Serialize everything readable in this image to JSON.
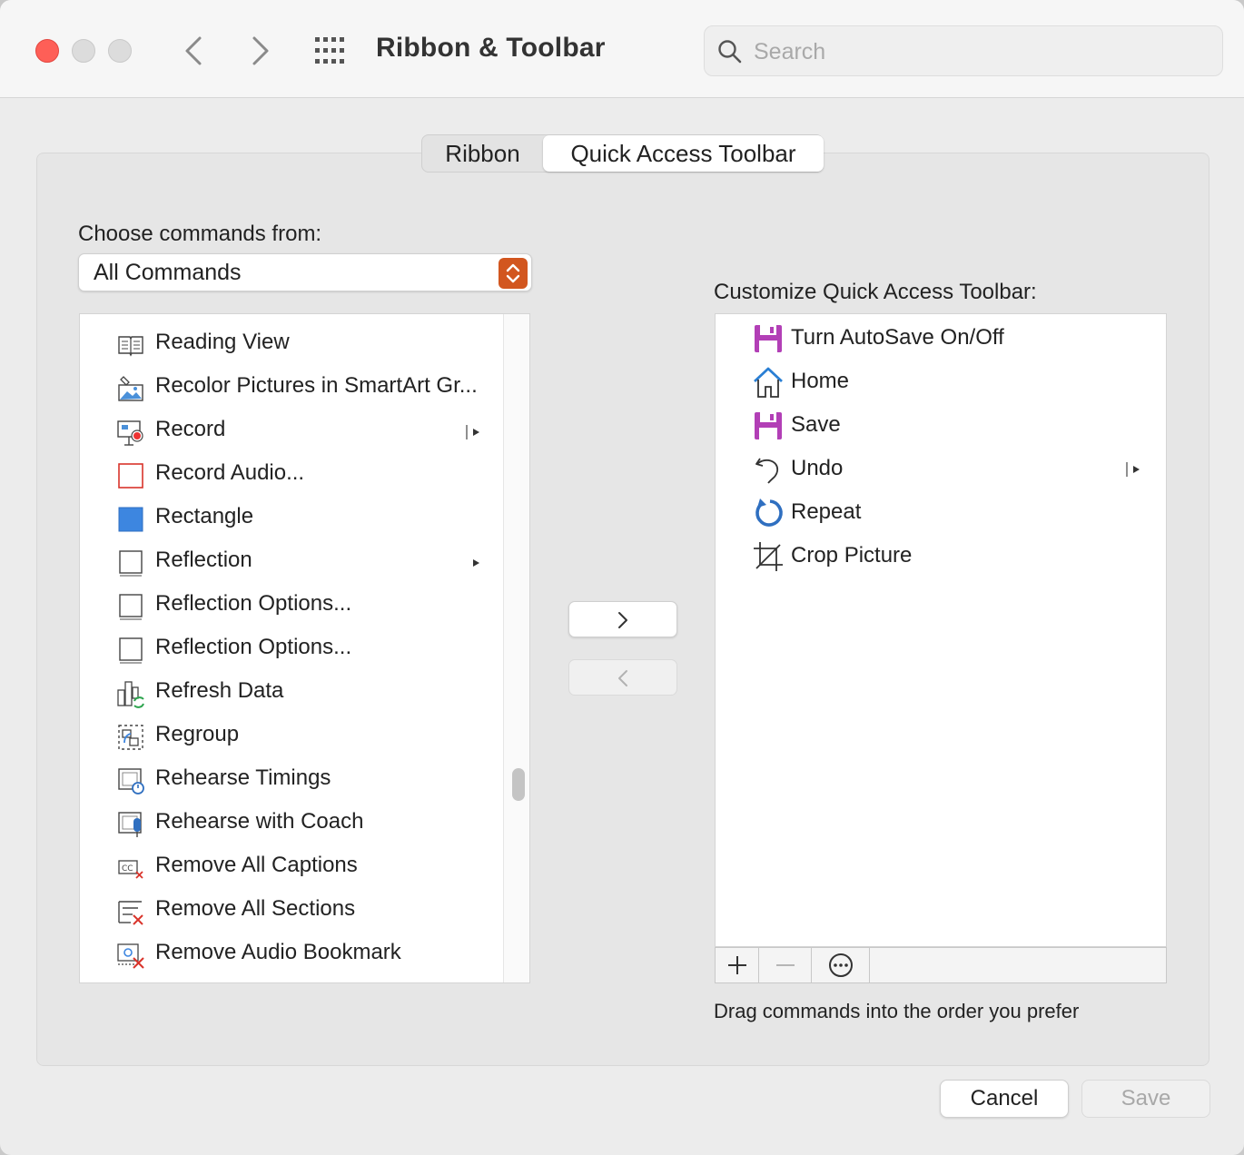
{
  "window": {
    "title": "Ribbon & Toolbar",
    "search_placeholder": "Search"
  },
  "tabs": [
    {
      "label": "Ribbon",
      "selected": false
    },
    {
      "label": "Quick Access Toolbar",
      "selected": true
    }
  ],
  "left": {
    "choose_label": "Choose commands from:",
    "source_value": "All Commands",
    "commands": [
      {
        "label": "Reading View",
        "icon": "reading-view-icon",
        "submenu": false
      },
      {
        "label": "Recolor Pictures in SmartArt Gr...",
        "icon": "recolor-pictures-icon",
        "submenu": false
      },
      {
        "label": "Record",
        "icon": "record-icon",
        "submenu": true
      },
      {
        "label": "Record Audio...",
        "icon": "record-audio-icon",
        "submenu": false
      },
      {
        "label": "Rectangle",
        "icon": "rectangle-icon",
        "submenu": false
      },
      {
        "label": "Reflection",
        "icon": "reflection-icon",
        "submenu": true
      },
      {
        "label": "Reflection Options...",
        "icon": "reflection-options-icon",
        "submenu": false
      },
      {
        "label": "Reflection Options...",
        "icon": "reflection-options-icon",
        "submenu": false
      },
      {
        "label": "Refresh Data",
        "icon": "refresh-data-icon",
        "submenu": false
      },
      {
        "label": "Regroup",
        "icon": "regroup-icon",
        "submenu": false
      },
      {
        "label": "Rehearse Timings",
        "icon": "rehearse-timings-icon",
        "submenu": false
      },
      {
        "label": "Rehearse with Coach",
        "icon": "rehearse-coach-icon",
        "submenu": false
      },
      {
        "label": "Remove All Captions",
        "icon": "remove-captions-icon",
        "submenu": false
      },
      {
        "label": "Remove All Sections",
        "icon": "remove-sections-icon",
        "submenu": false
      },
      {
        "label": "Remove Audio Bookmark",
        "icon": "remove-bookmark-icon",
        "submenu": false
      }
    ]
  },
  "right": {
    "customize_label": "Customize Quick Access Toolbar:",
    "items": [
      {
        "label": "Turn AutoSave On/Off",
        "icon": "autosave-icon",
        "submenu": false
      },
      {
        "label": "Home",
        "icon": "home-icon",
        "submenu": false
      },
      {
        "label": "Save",
        "icon": "save-icon",
        "submenu": false
      },
      {
        "label": "Undo",
        "icon": "undo-icon",
        "submenu": true
      },
      {
        "label": "Repeat",
        "icon": "repeat-icon",
        "submenu": false
      },
      {
        "label": "Crop Picture",
        "icon": "crop-picture-icon",
        "submenu": false
      }
    ],
    "hint": "Drag commands into the order you prefer"
  },
  "buttons": {
    "cancel": "Cancel",
    "save": "Save"
  },
  "colors": {
    "close": "#fe5f57",
    "accent_popup": "#d2561f",
    "save_icon": "#b23fb6",
    "home_icon": "#2a7fd4"
  }
}
